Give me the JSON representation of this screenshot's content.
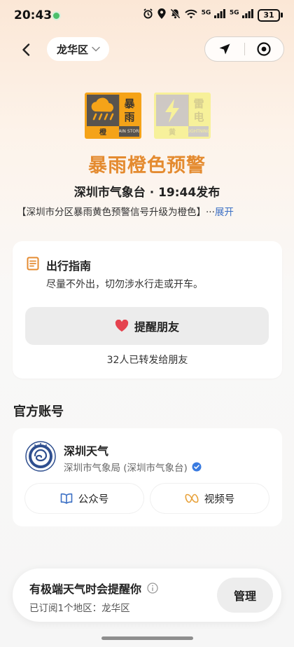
{
  "status_bar": {
    "time": "20:43",
    "battery": "31",
    "signal_label_1": "5G",
    "signal_label_2": "5G"
  },
  "nav": {
    "district": "龙华区"
  },
  "signals": {
    "rain": {
      "chars": [
        "暴",
        "雨"
      ],
      "level": "橙",
      "english": "RAIN STORM"
    },
    "lightning": {
      "chars": [
        "雷",
        "电"
      ],
      "level": "黄",
      "english": "LIGHTNING"
    }
  },
  "warning": {
    "title": "暴雨橙色预警",
    "issuer": "深圳市气象台 · 19:44发布",
    "summary": "【深圳市分区暴雨黄色预警信号升级为橙色】",
    "ellipsis": "...",
    "expand_label": "展开"
  },
  "guide": {
    "title": "出行指南",
    "text": "尽量不外出，切勿涉水行走或开车。",
    "remind_label": "提醒朋友",
    "forward_count": "32人已转发给朋友"
  },
  "official": {
    "section_title": "官方账号",
    "account_name": "深圳天气",
    "account_org": "深圳市气象局 (深圳市气象台)",
    "official_account_label": "公众号",
    "channels_label": "视频号"
  },
  "subscription": {
    "title": "有极端天气时会提醒你",
    "subtitle": "已订阅1个地区：龙华区",
    "manage_label": "管理"
  },
  "colors": {
    "warning_orange": "#e48b30",
    "signal_orange": "#f5a318",
    "link_blue": "#3b6fc4",
    "heart_red": "#e5434f",
    "verified_blue": "#3a7be0"
  }
}
